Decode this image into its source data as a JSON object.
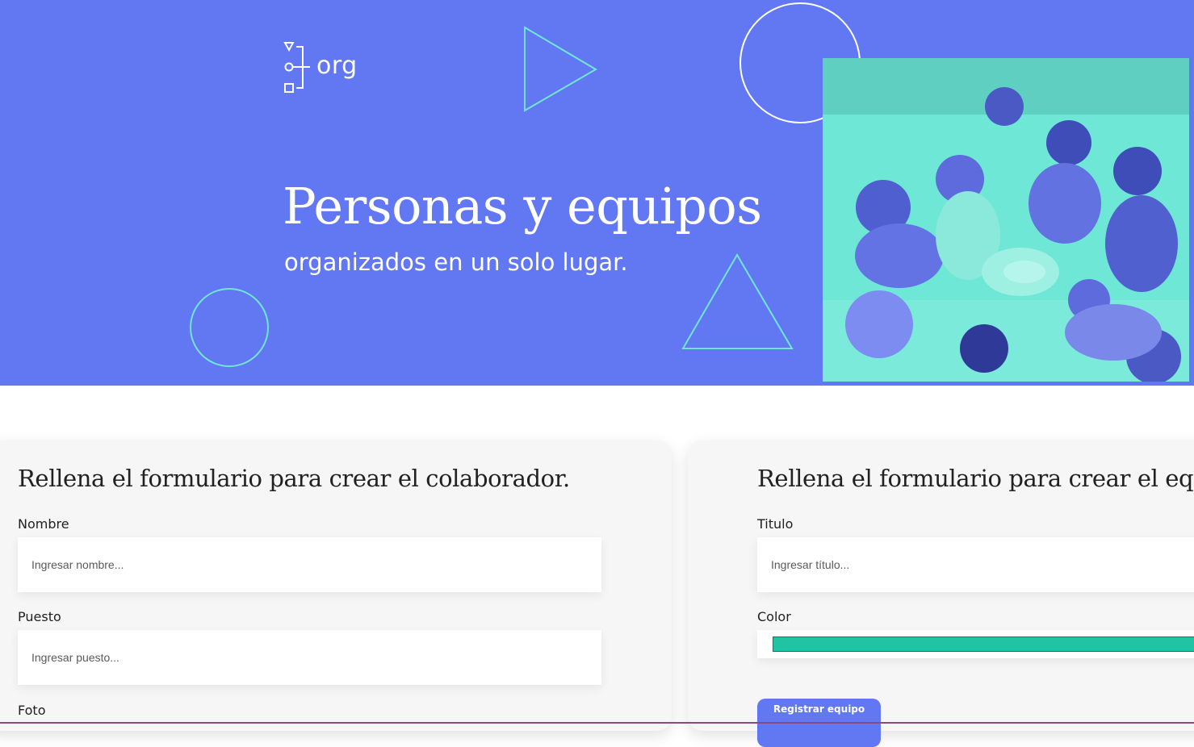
{
  "header": {
    "logo_text": "org",
    "title": "Personas y equipos",
    "subtitle": "organizados en un solo lugar."
  },
  "colors": {
    "brand": "#6278F2",
    "accent": "#6FE7D7",
    "team_color": "#20C3A4"
  },
  "collaborator_form": {
    "title": "Rellena el formulario para crear el colaborador.",
    "name_label": "Nombre",
    "name_placeholder": "Ingresar nombre...",
    "position_label": "Puesto",
    "position_placeholder": "Ingresar puesto...",
    "photo_label": "Foto"
  },
  "team_form": {
    "title": "Rellena el formulario para crear el equipo.",
    "title_label": "Titulo",
    "title_placeholder": "Ingresar título...",
    "color_label": "Color",
    "submit_label": "Registrar equipo"
  }
}
